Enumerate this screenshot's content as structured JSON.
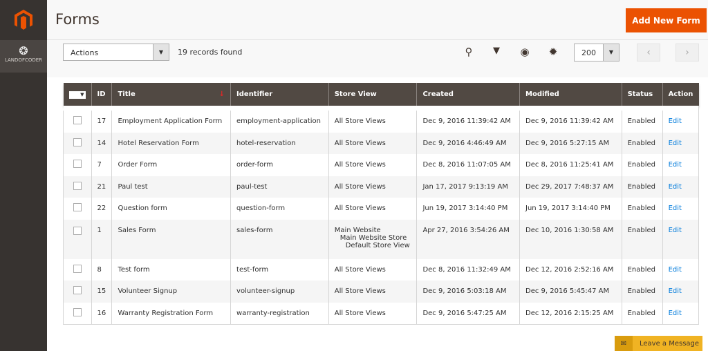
{
  "sidebar": {
    "brand": "LANDOFCODER"
  },
  "header": {
    "title": "Forms",
    "add_button": "Add New Form"
  },
  "toolbar": {
    "actions": "Actions",
    "records": "19 records found",
    "per_page": "200",
    "prev": "‹",
    "next": "›"
  },
  "columns": [
    "ID",
    "Title",
    "Identifier",
    "Store View",
    "Created",
    "Modified",
    "Status",
    "Action"
  ],
  "rows": [
    {
      "id": "17",
      "title": "Employment Application Form",
      "identifier": "employment-application",
      "store": [
        "All Store Views"
      ],
      "created": "Dec 9, 2016 11:39:42 AM",
      "modified": "Dec 9, 2016 11:39:42 AM",
      "status": "Enabled",
      "action": "Edit"
    },
    {
      "id": "14",
      "title": "Hotel Reservation Form",
      "identifier": "hotel-reservation",
      "store": [
        "All Store Views"
      ],
      "created": "Dec 9, 2016 4:46:49 AM",
      "modified": "Dec 9, 2016 5:27:15 AM",
      "status": "Enabled",
      "action": "Edit"
    },
    {
      "id": "7",
      "title": "Order Form",
      "identifier": "order-form",
      "store": [
        "All Store Views"
      ],
      "created": "Dec 8, 2016 11:07:05 AM",
      "modified": "Dec 8, 2016 11:25:41 AM",
      "status": "Enabled",
      "action": "Edit"
    },
    {
      "id": "21",
      "title": "Paul test",
      "identifier": "paul-test",
      "store": [
        "All Store Views"
      ],
      "created": "Jan 17, 2017 9:13:19 AM",
      "modified": "Dec 29, 2017 7:48:37 AM",
      "status": "Enabled",
      "action": "Edit"
    },
    {
      "id": "22",
      "title": "Question form",
      "identifier": "question-form",
      "store": [
        "All Store Views"
      ],
      "created": "Jun 19, 2017 3:14:40 PM",
      "modified": "Jun 19, 2017 3:14:40 PM",
      "status": "Enabled",
      "action": "Edit"
    },
    {
      "id": "1",
      "title": "Sales Form",
      "identifier": "sales-form",
      "store": [
        "Main Website",
        "Main Website Store",
        "Default Store View"
      ],
      "created": "Apr 27, 2016 3:54:26 AM",
      "modified": "Dec 10, 2016 1:30:58 AM",
      "status": "Enabled",
      "action": "Edit"
    },
    {
      "id": "8",
      "title": "Test form",
      "identifier": "test-form",
      "store": [
        "All Store Views"
      ],
      "created": "Dec 8, 2016 11:32:49 AM",
      "modified": "Dec 12, 2016 2:52:16 AM",
      "status": "Enabled",
      "action": "Edit"
    },
    {
      "id": "15",
      "title": "Volunteer Signup",
      "identifier": "volunteer-signup",
      "store": [
        "All Store Views"
      ],
      "created": "Dec 9, 2016 5:03:18 AM",
      "modified": "Dec 9, 2016 5:45:47 AM",
      "status": "Enabled",
      "action": "Edit"
    },
    {
      "id": "16",
      "title": "Warranty Registration Form",
      "identifier": "warranty-registration",
      "store": [
        "All Store Views"
      ],
      "created": "Dec 9, 2016 5:47:25 AM",
      "modified": "Dec 12, 2016 2:15:25 AM",
      "status": "Enabled",
      "action": "Edit"
    }
  ],
  "chat": {
    "label": "Leave a Message"
  }
}
